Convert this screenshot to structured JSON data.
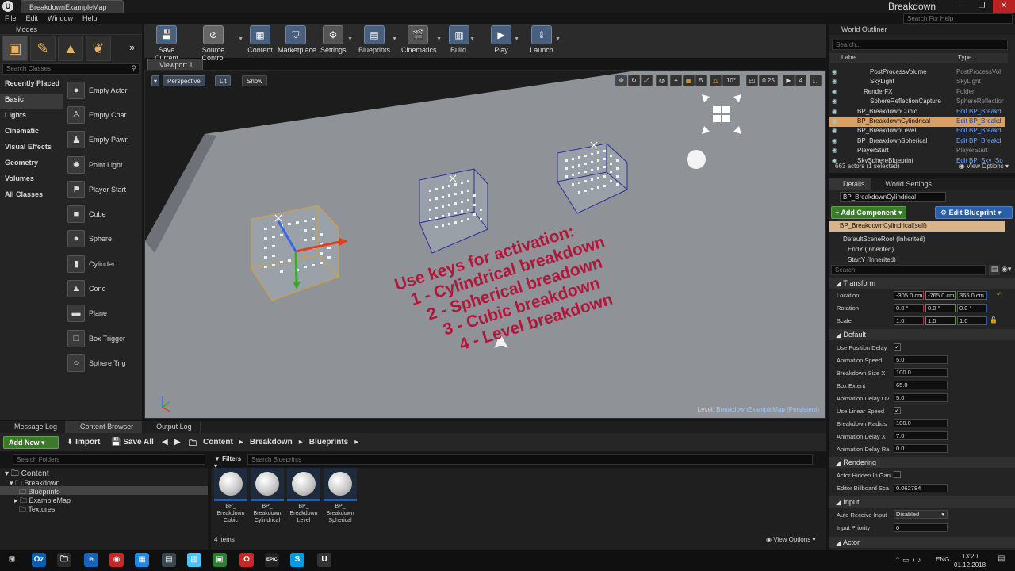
{
  "window": {
    "tab": "BreakdownExampleMap",
    "project": "Breakdown",
    "help_search": "Search For Help",
    "controls": [
      "–",
      "❐",
      "✕"
    ]
  },
  "menu": [
    "File",
    "Edit",
    "Window",
    "Help"
  ],
  "modes": {
    "title": "Modes",
    "search_placeholder": "Search Classes",
    "categories": [
      "Recently Placed",
      "Basic",
      "Lights",
      "Cinematic",
      "Visual Effects",
      "Geometry",
      "Volumes",
      "All Classes"
    ],
    "items": [
      "Empty Actor",
      "Empty Char",
      "Empty Pawn",
      "Point Light",
      "Player Start",
      "Cube",
      "Sphere",
      "Cylinder",
      "Cone",
      "Plane",
      "Box Trigger",
      "Sphere Trig"
    ]
  },
  "toolbar": [
    "Save Current",
    "Source Control",
    "Content",
    "Marketplace",
    "Settings",
    "Blueprints",
    "Cinematics",
    "Build",
    "Play",
    "Launch"
  ],
  "viewport": {
    "tab": "Viewport 1",
    "perspective": "Perspective",
    "lit": "Lit",
    "show": "Show",
    "snap_angle": "10°",
    "snap_grid": "5",
    "snap_scale": "0.25",
    "cam_speed": "4",
    "level_label": "Level:",
    "level_name": "BreakdownExampleMap (Persistent)",
    "instructions": [
      "Use keys for activation:",
      "1 - Cylindrical breakdown",
      "2 - Spherical breadown",
      "3 - Cubic breakdown",
      "4 - Level breakdown"
    ]
  },
  "bottom": {
    "tabs": [
      "Message Log",
      "Content Browser",
      "Output Log"
    ],
    "add_new": "Add New",
    "import": "Import",
    "save_all": "Save All",
    "breadcrumbs": [
      "Content",
      "Breakdown",
      "Blueprints"
    ],
    "folder_search": "Search Folders",
    "filters": "Filters",
    "bp_search": "Search Blueprints",
    "tree": [
      {
        "label": "Content",
        "depth": 0
      },
      {
        "label": "Breakdown",
        "depth": 1
      },
      {
        "label": "Blueprints",
        "depth": 2
      },
      {
        "label": "ExampleMap",
        "depth": 2
      },
      {
        "label": "Textures",
        "depth": 2
      }
    ],
    "assets": [
      {
        "line1": "BP_",
        "line2": "Breakdown",
        "line3": "Cubic"
      },
      {
        "line1": "BP_",
        "line2": "Breakdown",
        "line3": "Cylindrical"
      },
      {
        "line1": "BP_",
        "line2": "Breakdown",
        "line3": "Level"
      },
      {
        "line1": "BP_",
        "line2": "Breakdown",
        "line3": "Spherical"
      }
    ],
    "item_count": "4 items",
    "view_options": "View Options"
  },
  "outliner": {
    "title": "World Outliner",
    "search": "Search...",
    "col_label": "Label",
    "col_type": "Type",
    "rows": [
      {
        "label": "PostProcessVolume",
        "type": "PostProcessVol",
        "indent": 2,
        "link": false
      },
      {
        "label": "SkyLight",
        "type": "SkyLight",
        "indent": 2,
        "link": false
      },
      {
        "label": "RenderFX",
        "type": "Folder",
        "indent": 1,
        "link": false
      },
      {
        "label": "SphereReflectionCapture",
        "type": "SphereReflection",
        "indent": 2,
        "link": false
      },
      {
        "label": "BP_BreakdownCubic",
        "type": "Edit BP_Breakd",
        "indent": 0,
        "link": true
      },
      {
        "label": "BP_BreakdownCylindrical",
        "type": "Edit BP_Breakd",
        "indent": 0,
        "link": true,
        "selected": true
      },
      {
        "label": "BP_BreakdownLevel",
        "type": "Edit BP_Breakd",
        "indent": 0,
        "link": true
      },
      {
        "label": "BP_BreakdownSpherical",
        "type": "Edit BP_Breakd",
        "indent": 0,
        "link": true
      },
      {
        "label": "PlayerStart",
        "type": "PlayerStart",
        "indent": 0,
        "link": false
      },
      {
        "label": "SkySphereBlueprint",
        "type": "Edit BP_Sky_Sp",
        "indent": 0,
        "link": true
      }
    ],
    "footer": "663 actors (1 selected)",
    "view_options": "View Options"
  },
  "details": {
    "tabs": [
      "Details",
      "World Settings"
    ],
    "actor_name": "BP_BreakdownCylindrical",
    "add_component": "Add Component",
    "edit_blueprint": "Edit Blueprint",
    "components": [
      "BP_BreakdownCylindrical(self)",
      "DefaultSceneRoot (Inherited)",
      "EndY (Inherited)",
      "StartY (Inherited)"
    ],
    "search": "Search",
    "transform": {
      "title": "Transform",
      "location_label": "Location",
      "location": [
        "-305.0 cm",
        "-765.0 cm",
        "365.0 cm"
      ],
      "rotation_label": "Rotation",
      "rotation": [
        "0.0 °",
        "0.0 °",
        "0.0 °"
      ],
      "scale_label": "Scale",
      "scale": [
        "1.0",
        "1.0",
        "1.0"
      ]
    },
    "default": {
      "title": "Default",
      "props": [
        {
          "label": "Use Position Delay",
          "kind": "check",
          "value": "✓"
        },
        {
          "label": "Animation Speed",
          "kind": "num",
          "value": "5.0"
        },
        {
          "label": "Breakdown Size X",
          "kind": "num",
          "value": "100.0"
        },
        {
          "label": "Box Extent",
          "kind": "num",
          "value": "65.0"
        },
        {
          "label": "Animation Delay Ov",
          "kind": "num",
          "value": "5.0"
        },
        {
          "label": "Use Linear Speed",
          "kind": "check",
          "value": "✓"
        },
        {
          "label": "Breakdown Radius",
          "kind": "num",
          "value": "100.0"
        },
        {
          "label": "Animation Delay X",
          "kind": "num",
          "value": "7.0"
        },
        {
          "label": "Animation Delay Ra",
          "kind": "num",
          "value": "0.0"
        }
      ]
    },
    "rendering": {
      "title": "Rendering",
      "hidden_label": "Actor Hidden In Gan",
      "billboard_label": "Editor Billboard Sca",
      "billboard_value": "0.062784"
    },
    "input": {
      "title": "Input",
      "auto_label": "Auto Receive Input",
      "auto_value": "Disabled",
      "priority_label": "Input Priority",
      "priority_value": "0"
    },
    "actor_title": "Actor"
  },
  "taskbar": {
    "icons": [
      {
        "glyph": "⊞",
        "color": "#101010"
      },
      {
        "glyph": "Oz",
        "color": "#0a5fb4"
      },
      {
        "glyph": "🗀",
        "color": "#2b2b2b"
      },
      {
        "glyph": "e",
        "color": "#1565c0"
      },
      {
        "glyph": "◉",
        "color": "#c62828"
      },
      {
        "glyph": "▦",
        "color": "#1e88e5"
      },
      {
        "glyph": "▤",
        "color": "#37474f"
      },
      {
        "glyph": "▧",
        "color": "#4fc3f7"
      },
      {
        "glyph": "▣",
        "color": "#2e7d32"
      },
      {
        "glyph": "O",
        "color": "#c62828"
      },
      {
        "glyph": "EPIC",
        "color": "#222"
      },
      {
        "glyph": "S",
        "color": "#039be5"
      },
      {
        "glyph": "U",
        "color": "#333"
      }
    ],
    "lang": "ENG",
    "time": "13:20",
    "date": "01.12.2018"
  }
}
